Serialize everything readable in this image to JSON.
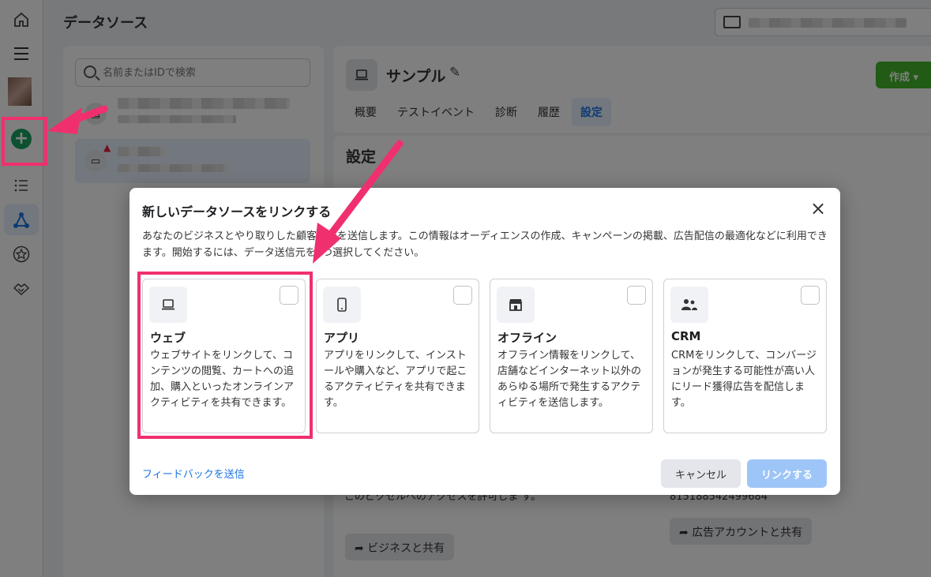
{
  "rail": {
    "icons": [
      "home-icon",
      "menu-icon",
      "avatar",
      "add-icon",
      "list-icon",
      "data-sources-icon",
      "star-icon",
      "handshake-icon"
    ]
  },
  "header": {
    "title": "データソース"
  },
  "search": {
    "placeholder": "名前またはIDで検索"
  },
  "detail": {
    "name": "サンプル",
    "create_label": "作成",
    "tabs": [
      {
        "label": "概要"
      },
      {
        "label": "テストイベント"
      },
      {
        "label": "診断"
      },
      {
        "label": "履歴"
      },
      {
        "label": "設定",
        "active": true
      }
    ],
    "settings_title": "設定",
    "bg_text_left": "このピクセルへのアクセスを許可しま す。",
    "bg_id": "815188542499684",
    "share_business": "ビジネスと共有",
    "share_ad_account": "広告アカウントと共有"
  },
  "modal": {
    "title": "新しいデータソースをリンクする",
    "close_label": "×",
    "description": "あなたのビジネスとやり取りした顧客情報を送信します。この情報はオーディエンスの作成、キャンペーンの掲載、広告配信の最適化などに利用できます。開始するには、データ送信元を1つ選択してください。",
    "options": [
      {
        "title": "ウェブ",
        "description": "ウェブサイトをリンクして、コンテンツの閲覧、カートへの追加、購入といったオンラインアクティビティを共有できます。",
        "icon": "laptop-icon"
      },
      {
        "title": "アプリ",
        "description": "アプリをリンクして、インストールや購入など、アプリで起こるアクティビティを共有できます。",
        "icon": "phone-icon"
      },
      {
        "title": "オフライン",
        "description": "オフライン情報をリンクして、店舗などインターネット以外のあらゆる場所で発生するアクティビティを送信します。",
        "icon": "store-icon"
      },
      {
        "title": "CRM",
        "description": "CRMをリンクして、コンバージョンが発生する可能性が高い人にリード獲得広告を配信します。",
        "icon": "people-icon"
      }
    ],
    "feedback_label": "フィードバックを送信",
    "cancel_label": "キャンセル",
    "link_label": "リンクする"
  },
  "annotation_color": "#f0306e"
}
